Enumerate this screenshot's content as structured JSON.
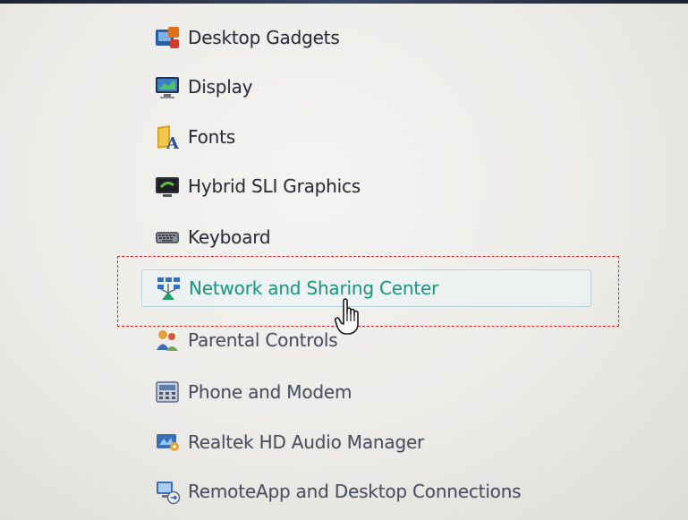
{
  "control_panel": {
    "items": [
      {
        "label": "Desktop Gadgets",
        "icon": "desktop-gadgets-icon"
      },
      {
        "label": "Display",
        "icon": "display-icon"
      },
      {
        "label": "Fonts",
        "icon": "fonts-icon"
      },
      {
        "label": "Hybrid SLI Graphics",
        "icon": "hybrid-sli-graphics-icon"
      },
      {
        "label": "Keyboard",
        "icon": "keyboard-icon"
      },
      {
        "label": "Network and Sharing Center",
        "icon": "network-sharing-icon",
        "state": "hovered"
      },
      {
        "label": "Parental Controls",
        "icon": "parental-controls-icon"
      },
      {
        "label": "Phone and Modem",
        "icon": "phone-modem-icon"
      },
      {
        "label": "Realtek HD Audio Manager",
        "icon": "realtek-audio-icon"
      },
      {
        "label": "RemoteApp and Desktop Connections",
        "icon": "remoteapp-icon"
      }
    ]
  },
  "annotation": {
    "highlight_color": "#e0201e",
    "cursor": "hand-pointer-cursor"
  },
  "colors": {
    "text": "#2d2f3a",
    "hover_text": "#1f9a86",
    "hover_border": "#b8d2d8"
  }
}
